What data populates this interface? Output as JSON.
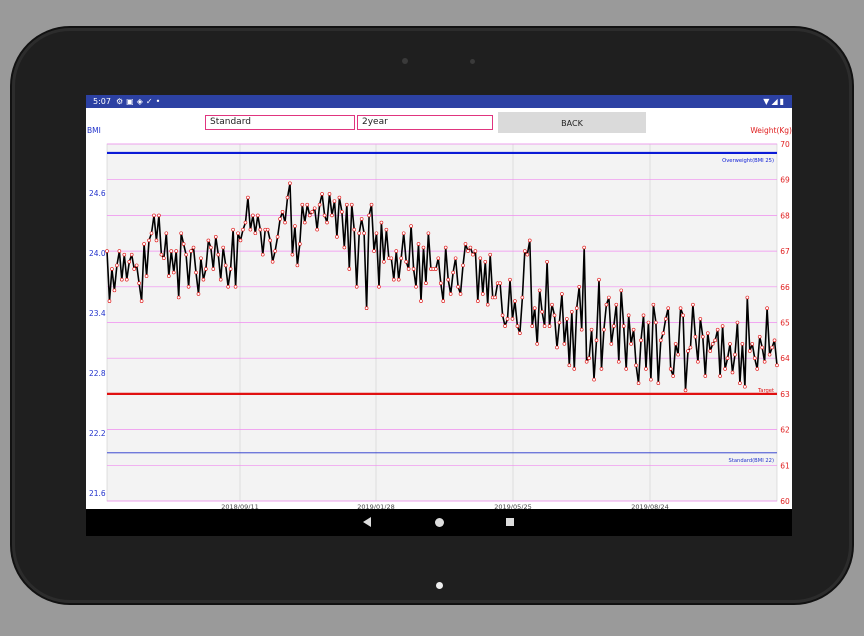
{
  "status_bar": {
    "time": "5:07",
    "left_icons": [
      "gear-icon",
      "a-icon",
      "shield-icon",
      "check-icon",
      "dot-icon"
    ],
    "right_icons": [
      "wifi-icon",
      "signal-icon",
      "battery-icon"
    ]
  },
  "toolbar": {
    "mode_select": "Standard",
    "period_select": "2year",
    "back_label": "BACK"
  },
  "axis_labels": {
    "left": "BMI",
    "right": "Weight(Kg)"
  },
  "colors": {
    "statusbar": "#2c41a3",
    "weight_line": "#000000",
    "overweight_line": "#0a1ad6",
    "target_line": "#e01010",
    "standard_line": "#2233cc",
    "combo_border": "#e0357f"
  },
  "chart_data": {
    "type": "line",
    "y_right": {
      "min": 60,
      "max": 70,
      "ticks": [
        "70",
        "69",
        "68",
        "67",
        "66",
        "65",
        "64",
        "63",
        "62",
        "61",
        "60"
      ]
    },
    "y_left": {
      "ticks": [
        "24.6",
        "24.0",
        "23.4",
        "22.8",
        "22.2",
        "21.6"
      ],
      "values": [
        24.6,
        24.0,
        23.4,
        22.8,
        22.2,
        21.6
      ]
    },
    "x_tick_labels": [
      "2018/09/11",
      "2019/01/28",
      "2019/05/25",
      "2019/08/24"
    ],
    "reference_lines": [
      {
        "label": "Overweight(BMI 25)",
        "weight": 69.75
      },
      {
        "label": "Target",
        "weight": 63.0
      },
      {
        "label": "Standard(BMI 22)",
        "weight": 61.35
      }
    ],
    "series": [
      {
        "values": [
          67.0,
          65.6,
          66.5,
          65.9,
          66.6,
          67.0,
          66.2,
          66.9,
          66.2,
          66.7,
          66.9,
          66.5,
          66.6,
          66.1,
          65.6,
          67.2,
          66.3,
          67.3,
          67.5,
          68.0,
          67.3,
          68.0,
          66.9,
          66.8,
          67.5,
          66.3,
          67.0,
          66.4,
          67.0,
          65.7,
          67.5,
          67.2,
          66.9,
          66.0,
          67.0,
          67.1,
          66.4,
          65.8,
          66.8,
          66.2,
          66.5,
          67.3,
          67.1,
          66.5,
          67.4,
          66.9,
          66.2,
          67.1,
          66.6,
          66.0,
          66.5,
          67.6,
          66.0,
          67.5,
          67.3,
          67.6,
          67.8,
          68.5,
          67.6,
          68.0,
          67.5,
          68.0,
          67.6,
          66.9,
          67.6,
          67.6,
          67.3,
          66.7,
          67.0,
          67.4,
          67.9,
          68.1,
          67.8,
          68.5,
          68.9,
          66.9,
          67.7,
          66.6,
          67.2,
          68.3,
          67.8,
          68.3,
          68.0,
          68.1,
          68.2,
          67.6,
          68.3,
          68.6,
          68.0,
          67.8,
          68.6,
          68.0,
          68.4,
          67.4,
          68.5,
          68.1,
          67.1,
          68.3,
          66.5,
          68.3,
          67.6,
          66.0,
          67.5,
          67.9,
          67.5,
          65.4,
          68.0,
          68.3,
          67.0,
          67.5,
          66.0,
          67.8,
          66.7,
          67.6,
          66.8,
          66.8,
          66.2,
          67.0,
          66.2,
          66.8,
          67.5,
          66.7,
          66.5,
          67.7,
          66.5,
          66.0,
          67.2,
          65.6,
          67.1,
          66.1,
          67.5,
          66.5,
          66.5,
          66.5,
          66.8,
          66.1,
          65.6,
          67.1,
          66.2,
          65.8,
          66.4,
          66.8,
          66.0,
          65.8,
          66.6,
          67.2,
          67.0,
          67.1,
          66.9,
          67.0,
          65.6,
          66.8,
          65.8,
          66.7,
          65.5,
          66.9,
          65.7,
          65.7,
          66.1,
          66.1,
          65.2,
          64.9,
          65.1,
          66.2,
          65.1,
          65.6,
          64.9,
          64.7,
          65.7,
          67.0,
          66.9,
          67.3,
          64.9,
          65.4,
          64.4,
          65.9,
          65.3,
          64.9,
          66.7,
          64.9,
          65.5,
          65.2,
          64.3,
          65.0,
          65.8,
          64.4,
          65.1,
          63.8,
          65.3,
          63.7,
          65.4,
          66.0,
          64.8,
          67.1,
          63.9,
          64.0,
          64.8,
          63.4,
          64.5,
          66.2,
          63.7,
          64.8,
          65.5,
          65.7,
          64.4,
          64.9,
          65.5,
          63.9,
          65.9,
          64.9,
          63.7,
          65.2,
          64.4,
          64.8,
          63.8,
          63.3,
          64.5,
          65.2,
          63.7,
          65.0,
          63.4,
          65.5,
          65.0,
          63.3,
          64.5,
          64.7,
          65.1,
          65.4,
          63.7,
          63.5,
          64.4,
          64.1,
          65.4,
          65.2,
          63.1,
          64.2,
          64.3,
          65.5,
          64.6,
          63.9,
          65.1,
          64.6,
          63.5,
          64.7,
          64.2,
          64.4,
          64.5,
          64.8,
          63.5,
          64.9,
          63.7,
          64.0,
          64.4,
          63.6,
          64.1,
          65.0,
          63.3,
          64.4,
          63.2,
          65.7,
          64.2,
          64.4,
          64.0,
          63.7,
          64.6,
          64.3,
          63.9,
          65.4,
          64.1,
          64.3,
          64.5,
          63.8
        ]
      }
    ]
  }
}
